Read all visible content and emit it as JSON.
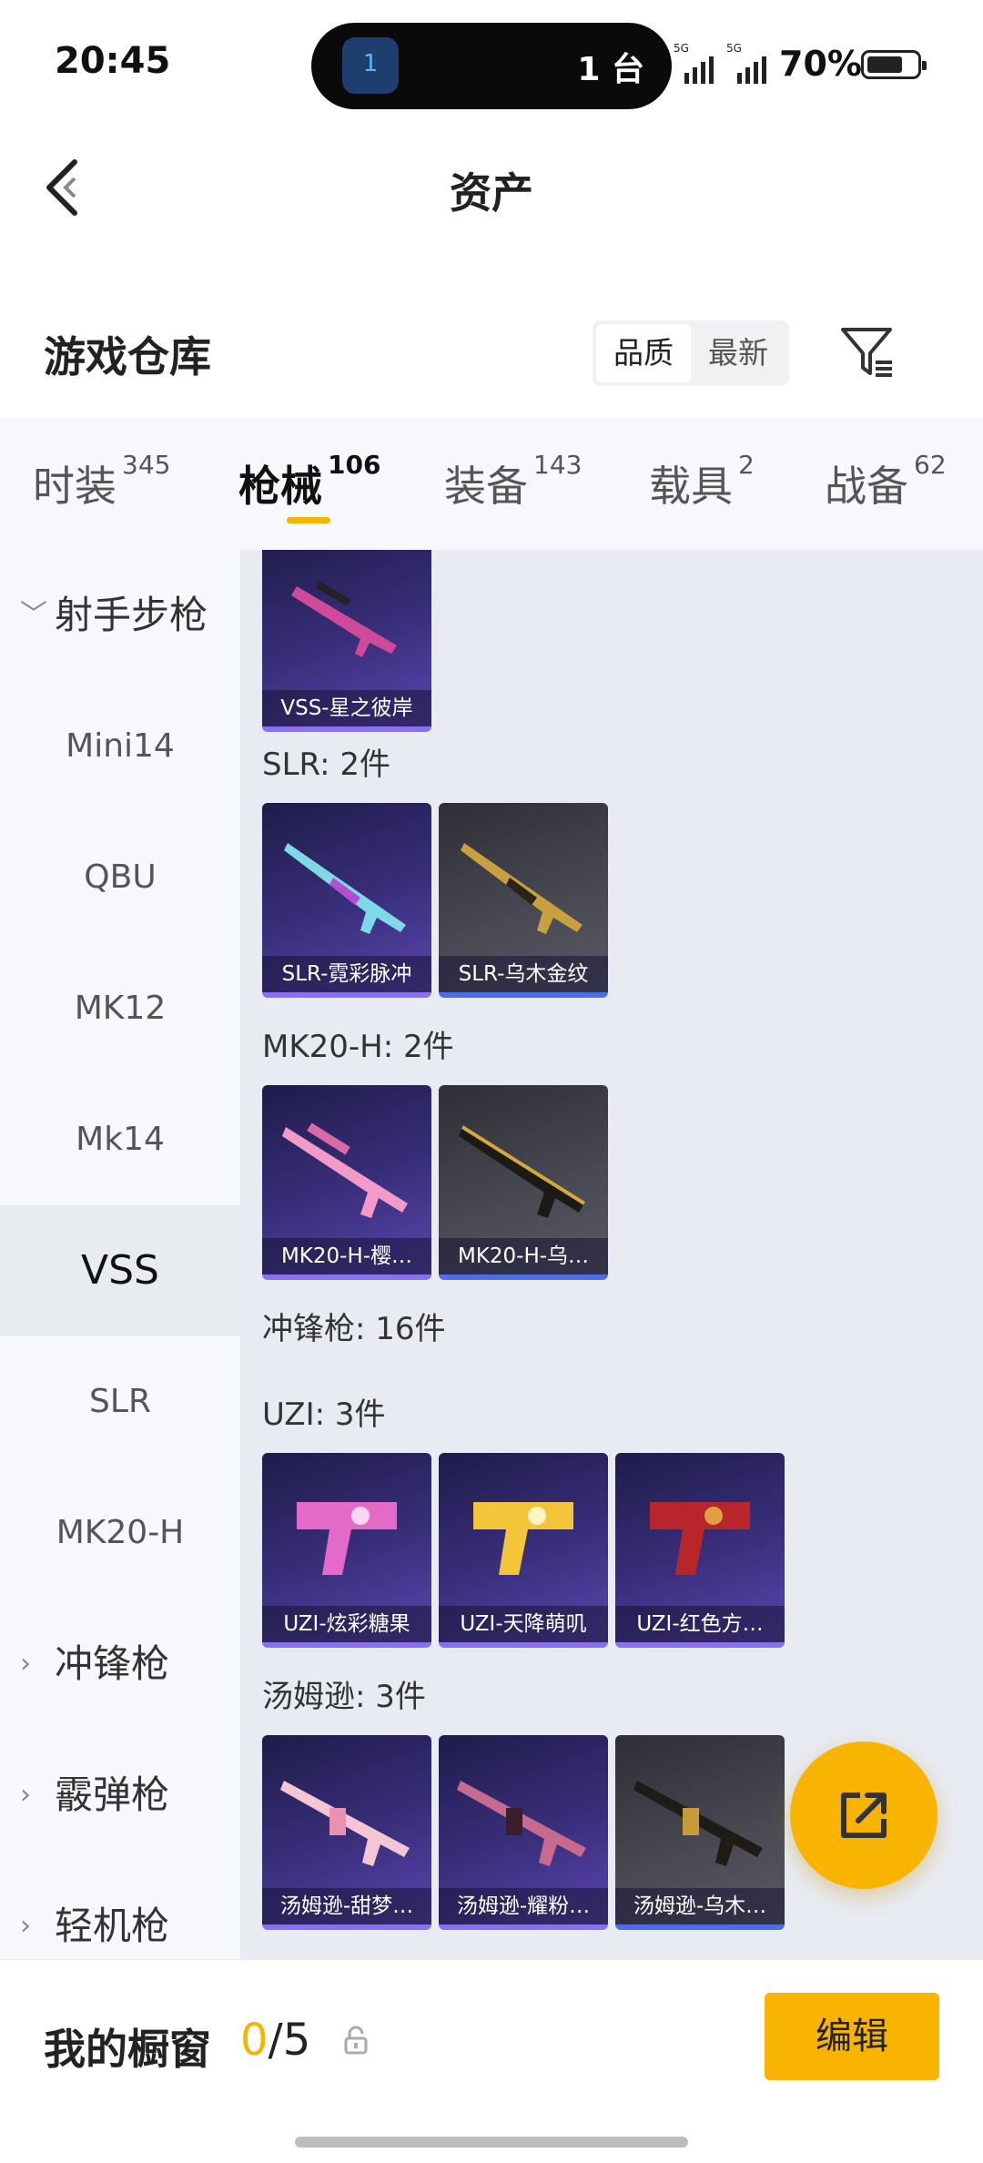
{
  "status_bar": {
    "time": "20:45",
    "island_badge": "1",
    "island_text": "1 台",
    "network_1": "5G",
    "network_2": "5G",
    "battery": "70%",
    "battery_level": 0.7
  },
  "header": {
    "title": "资产"
  },
  "warehouse": {
    "title": "游戏仓库",
    "sort_options": [
      "品质",
      "最新"
    ],
    "sort_active": "品质"
  },
  "tabs": [
    {
      "label": "时装",
      "count": "345"
    },
    {
      "label": "枪械",
      "count": "106",
      "active": true
    },
    {
      "label": "装备",
      "count": "143"
    },
    {
      "label": "载具",
      "count": "2"
    },
    {
      "label": "战备",
      "count": "62"
    }
  ],
  "sidebar": [
    {
      "label": "射手步枪",
      "type": "group",
      "expanded": true
    },
    {
      "label": "Mini14",
      "type": "item"
    },
    {
      "label": "QBU",
      "type": "item"
    },
    {
      "label": "MK12",
      "type": "item"
    },
    {
      "label": "Mk14",
      "type": "item"
    },
    {
      "label": "VSS",
      "type": "item",
      "active": true
    },
    {
      "label": "SLR",
      "type": "item"
    },
    {
      "label": "MK20-H",
      "type": "item"
    },
    {
      "label": "冲锋枪",
      "type": "group"
    },
    {
      "label": "霰弹枪",
      "type": "group"
    },
    {
      "label": "轻机枪",
      "type": "group"
    }
  ],
  "content": {
    "sections": [
      {
        "title": "",
        "items": [
          {
            "name": "VSS-星之彼岸",
            "color": "purple",
            "icon": "sniper-rifle-icon"
          }
        ]
      },
      {
        "title": "SLR: 2件",
        "items": [
          {
            "name": "SLR-霓彩脉冲",
            "color": "purple",
            "icon": "rifle-icon"
          },
          {
            "name": "SLR-乌木金纹",
            "color": "grey",
            "icon": "rifle-icon"
          }
        ]
      },
      {
        "title": "MK20-H: 2件",
        "items": [
          {
            "name": "MK20-H-樱…",
            "color": "purple",
            "icon": "rifle-icon"
          },
          {
            "name": "MK20-H-乌…",
            "color": "grey",
            "icon": "rifle-icon"
          }
        ]
      },
      {
        "title": "冲锋枪: 16件",
        "items": []
      },
      {
        "title": "UZI: 3件",
        "items": [
          {
            "name": "UZI-炫彩糖果",
            "color": "purple",
            "icon": "smg-icon"
          },
          {
            "name": "UZI-天降萌叽",
            "color": "purple",
            "icon": "smg-icon"
          },
          {
            "name": "UZI-红色方…",
            "color": "purple",
            "icon": "smg-icon"
          }
        ]
      },
      {
        "title": "汤姆逊: 3件",
        "items": [
          {
            "name": "汤姆逊-甜梦…",
            "color": "purple",
            "icon": "tommy-gun-icon"
          },
          {
            "name": "汤姆逊-耀粉…",
            "color": "purple",
            "icon": "tommy-gun-icon"
          },
          {
            "name": "汤姆逊-乌木…",
            "color": "grey",
            "icon": "tommy-gun-icon"
          }
        ]
      }
    ]
  },
  "bottom_bar": {
    "showcase_label": "我的橱窗",
    "showcase_current": "0",
    "showcase_total": "/5",
    "edit_label": "编辑"
  },
  "colors": {
    "accent": "#f8b400",
    "card_purple": "#3a2f7c",
    "card_grey": "#4a4a55"
  }
}
